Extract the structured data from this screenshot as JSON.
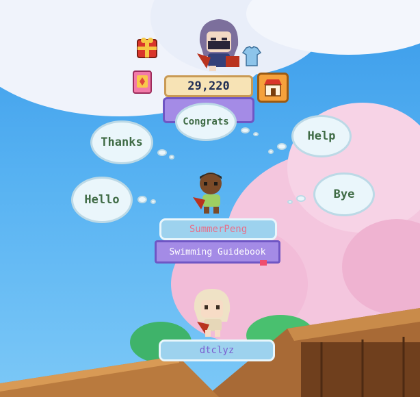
{
  "coins": "29,220",
  "quick_chat": {
    "congrats": "Congrats",
    "thanks": "Thanks",
    "help": "Help",
    "hello": "Hello",
    "bye": "Bye"
  },
  "players": {
    "middle_name": "SummerPeng",
    "middle_book": "Swimming Guidebook",
    "bottom_name": "dtclyz"
  },
  "icons": {
    "gift": "gift-icon",
    "card": "card-icon",
    "shop": "shop-icon",
    "shirt": "shirt-icon"
  },
  "colors": {
    "sky": "#57b2f2",
    "bubble_text": "#3f6b45",
    "name_pink": "#e7708a",
    "name_purple": "#7b5fd0",
    "book_plate": "#a48be6"
  }
}
